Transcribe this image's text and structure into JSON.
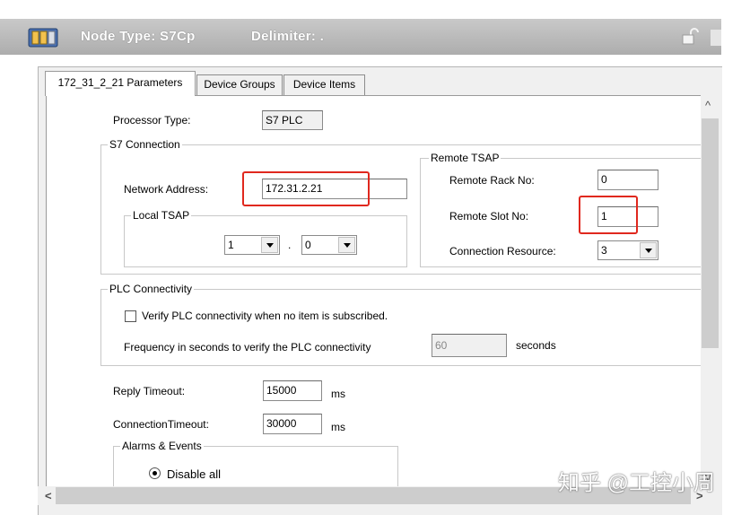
{
  "titlebar": {
    "node_type": "Node Type: S7Cp",
    "delimiter": "Delimiter: .",
    "app_icon": "plc-node-icon",
    "lock_icon": "lock-icon"
  },
  "tabs": [
    {
      "label": "172_31_2_21 Parameters",
      "active": true
    },
    {
      "label": "Device Groups",
      "active": false
    },
    {
      "label": "Device Items",
      "active": false
    }
  ],
  "processor": {
    "label": "Processor Type:",
    "value": "S7 PLC"
  },
  "s7_connection": {
    "title": "S7 Connection",
    "network_address_label": "Network Address:",
    "network_address_value": "172.31.2.21",
    "local_tsap": {
      "title": "Local TSAP",
      "rack": "1",
      "separator": ".",
      "slot": "0"
    },
    "remote_tsap": {
      "title": "Remote TSAP",
      "rack_label": "Remote Rack No:",
      "rack_value": "0",
      "slot_label": "Remote Slot No:",
      "slot_value": "1",
      "resource_label": "Connection Resource:",
      "resource_value": "3"
    }
  },
  "plc_connectivity": {
    "title": "PLC Connectivity",
    "verify_label": "Verify PLC connectivity when no item is subscribed.",
    "verify_checked": false,
    "frequency_label": "Frequency in seconds to verify the PLC connectivity",
    "frequency_value": "60",
    "frequency_unit": "seconds"
  },
  "timeouts": {
    "reply_label": "Reply Timeout:",
    "reply_value": "15000",
    "reply_unit": "ms",
    "connection_label": "ConnectionTimeout:",
    "connection_value": "30000",
    "connection_unit": "ms"
  },
  "alarms": {
    "title": "Alarms & Events",
    "disable_all_label": "Disable all",
    "disable_all_selected": true
  },
  "watermark": "知乎 @工控小周",
  "colors": {
    "highlight": "#e0281e",
    "titlebar": "#b8b8b8"
  }
}
